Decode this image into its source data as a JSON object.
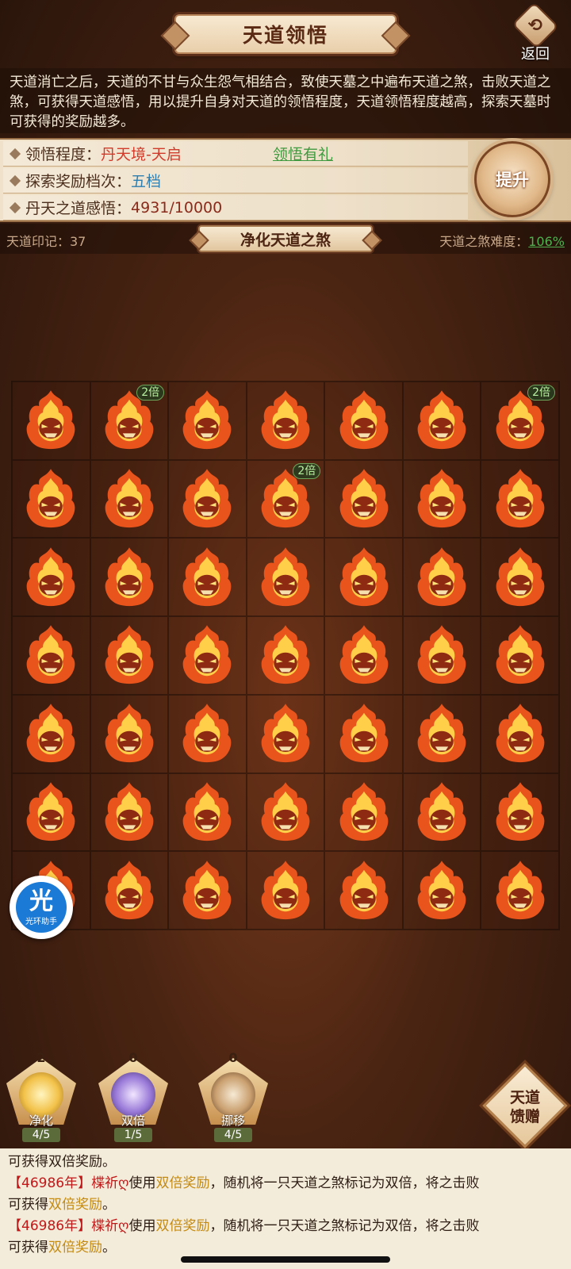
{
  "header": {
    "title": "天道领悟",
    "back_label": "返回",
    "back_glyph": "⟲"
  },
  "intro": "天道消亡之后，天道的不甘与众生怨气相结合，致使天墓之中遍布天道之煞，击败天道之煞，可获得天道感悟，用以提升自身对天道的领悟程度，天道领悟程度越高，探索天墓时可获得的奖励越多。",
  "stats": {
    "comprehension_label": "领悟程度：",
    "comprehension_value": "丹天境-天启",
    "gift_link": "领悟有礼",
    "reward_tier_label": "探索奖励档次：",
    "reward_tier_value": "五档",
    "insight_label": "丹天之道感悟：",
    "insight_value": "4931/10000",
    "upgrade_button": "提升"
  },
  "subbar": {
    "seal_label": "天道印记：37",
    "purify_title": "净化天道之煞",
    "difficulty_label": "天道之煞难度：",
    "difficulty_value": "106%"
  },
  "grid": {
    "rows": 7,
    "cols": 7,
    "badge_text": "2倍",
    "badges": [
      [
        0,
        1
      ],
      [
        0,
        6
      ],
      [
        1,
        3
      ]
    ],
    "colors": {
      "flame_outer": "#e8541c",
      "flame_inner": "#ffcf4a",
      "mask": "#8e2a12"
    }
  },
  "helper": {
    "glyph": "光",
    "label": "光环助手"
  },
  "skills": [
    {
      "name": "净化",
      "count": "2",
      "uses": "4/5",
      "color": "#f2c24a"
    },
    {
      "name": "双倍",
      "count": "0",
      "uses": "1/5",
      "color": "#9a7ad8"
    },
    {
      "name": "挪移",
      "count": "0",
      "uses": "4/5",
      "color": "#caa070"
    }
  ],
  "gift_button": {
    "line1": "天道",
    "line2": "馈赠"
  },
  "log": {
    "line0": "可获得双倍奖励。",
    "entries": [
      {
        "year": "【46986年】",
        "user": "楪祈ღ",
        "text1": "使用",
        "item": "双倍奖励",
        "text2": "，随机将一只天道之煞标记为双倍，将之击败",
        "text3": "可获得",
        "reward": "双倍奖励",
        "end": "。"
      },
      {
        "year": "【46986年】",
        "user": "楪祈ღ",
        "text1": "使用",
        "item": "双倍奖励",
        "text2": "，随机将一只天道之煞标记为双倍，将之击败",
        "text3": "可获得",
        "reward": "双倍奖励",
        "end": "。"
      }
    ]
  }
}
